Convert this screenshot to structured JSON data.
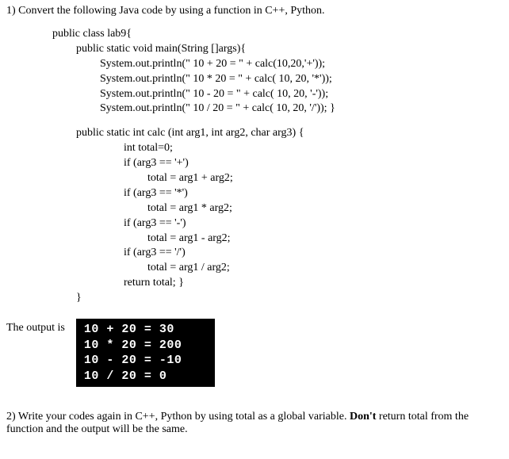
{
  "q1": {
    "prompt": "1) Convert the following Java code by using a function in C++, Python."
  },
  "code": {
    "l1": "public class lab9{",
    "l2": "public static void main(String []args){",
    "l3": "System.out.println(\" 10 + 20 = \" + calc(10,20,'+'));",
    "l4": "System.out.println(\" 10 * 20 = \" + calc( 10, 20, '*'));",
    "l5": "System.out.println(\" 10 - 20 = \" + calc( 10, 20, '-'));",
    "l6": "System.out.println(\" 10 / 20 = \" + calc( 10, 20, '/'));     }",
    "l7": "public static int calc (int arg1, int arg2, char arg3) {",
    "l8": "int total=0;",
    "l9": "if (arg3 == '+')",
    "l10": "total = arg1 + arg2;",
    "l11": "if (arg3 == '*')",
    "l12": "total = arg1 * arg2;",
    "l13": "if (arg3 == '-')",
    "l14": "total = arg1 - arg2;",
    "l15": "if (arg3 == '/')",
    "l16": "total = arg1 / arg2;",
    "l17": "return total;   }",
    "l18": "}"
  },
  "output": {
    "label": "The output is",
    "lines": {
      "o1": "10 + 20 = 30",
      "o2": "10 * 20 = 200",
      "o3": "10 - 20 = -10",
      "o4": "10 / 20 = 0"
    }
  },
  "q2": {
    "part1": "2) Write your codes again in C++, Python by using total as a global variable. ",
    "bold": "Don't",
    "part2": " return total from the function and the output will be the same."
  }
}
